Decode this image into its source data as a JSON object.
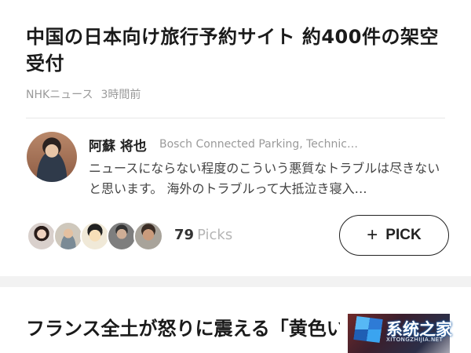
{
  "article": {
    "headline": "中国の日本向け旅行予約サイト 約400件の架空受付",
    "source": "NHKニュース",
    "time": "3時間前"
  },
  "comment": {
    "author": "阿蘇 将也",
    "company": "Bosch Connected Parking, Technic…",
    "body": "ニュースにならない程度のこういう悪質なトラブルは尽きないと思います。 海外のトラブルって大抵泣き寝入…"
  },
  "picks": {
    "count": "79",
    "label": "Picks",
    "button_icon": "+",
    "button_label": "PICK"
  },
  "next_article": {
    "headline": "フランス全土が怒りに震える「黄色いベスト」デモ"
  },
  "watermark": {
    "text": "系统之家",
    "sub": "XITONGZHIJIA.NET"
  }
}
